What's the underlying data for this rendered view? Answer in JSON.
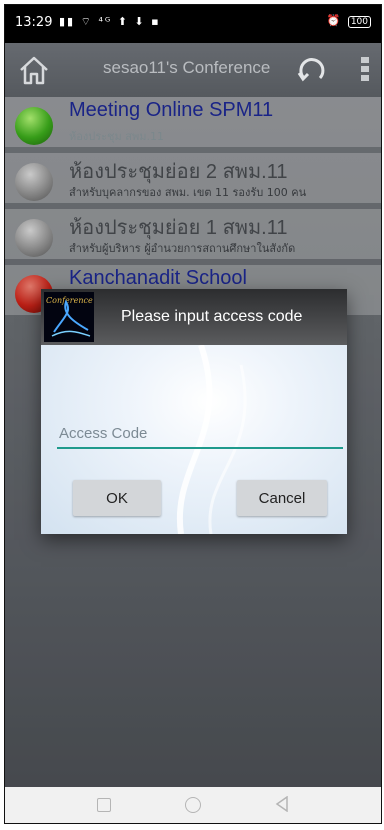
{
  "status": {
    "time": "13:29",
    "icons": "▮▮ ⌔ ⁴ᴳ ⬆ ⬇ ▪",
    "battery": "100",
    "alarm_icon": "alarm-icon"
  },
  "appbar": {
    "title": "sesao11's Conference",
    "home_icon": "home-icon",
    "refresh_icon": "refresh-icon",
    "menu_icon": "overflow-menu-icon"
  },
  "rooms": [
    {
      "title": "Meeting Online SPM11",
      "subtitle": "ห้องประชุม สพม.11",
      "status": "green"
    },
    {
      "title": "ห้องประชุมย่อย 2 สพม.11",
      "subtitle": "สำหรับบุคลากรของ สพม. เขต 11 รองรับ 100 คน",
      "status": "gray"
    },
    {
      "title": "ห้องประชุมย่อย 1 สพม.11",
      "subtitle": "สำหรับผู้บริหาร ผู้อำนวยการสถานศึกษาในสังกัด",
      "status": "gray"
    },
    {
      "title": "Kanchanadit School",
      "subtitle": "",
      "status": "red"
    }
  ],
  "dialog": {
    "logo_text": "Conference",
    "title": "Please input access code",
    "input_placeholder": "Access Code",
    "input_value": "",
    "ok_label": "OK",
    "cancel_label": "Cancel"
  },
  "colors": {
    "accent": "#1f9a8c",
    "room_title_active": "#1e2a9a"
  }
}
